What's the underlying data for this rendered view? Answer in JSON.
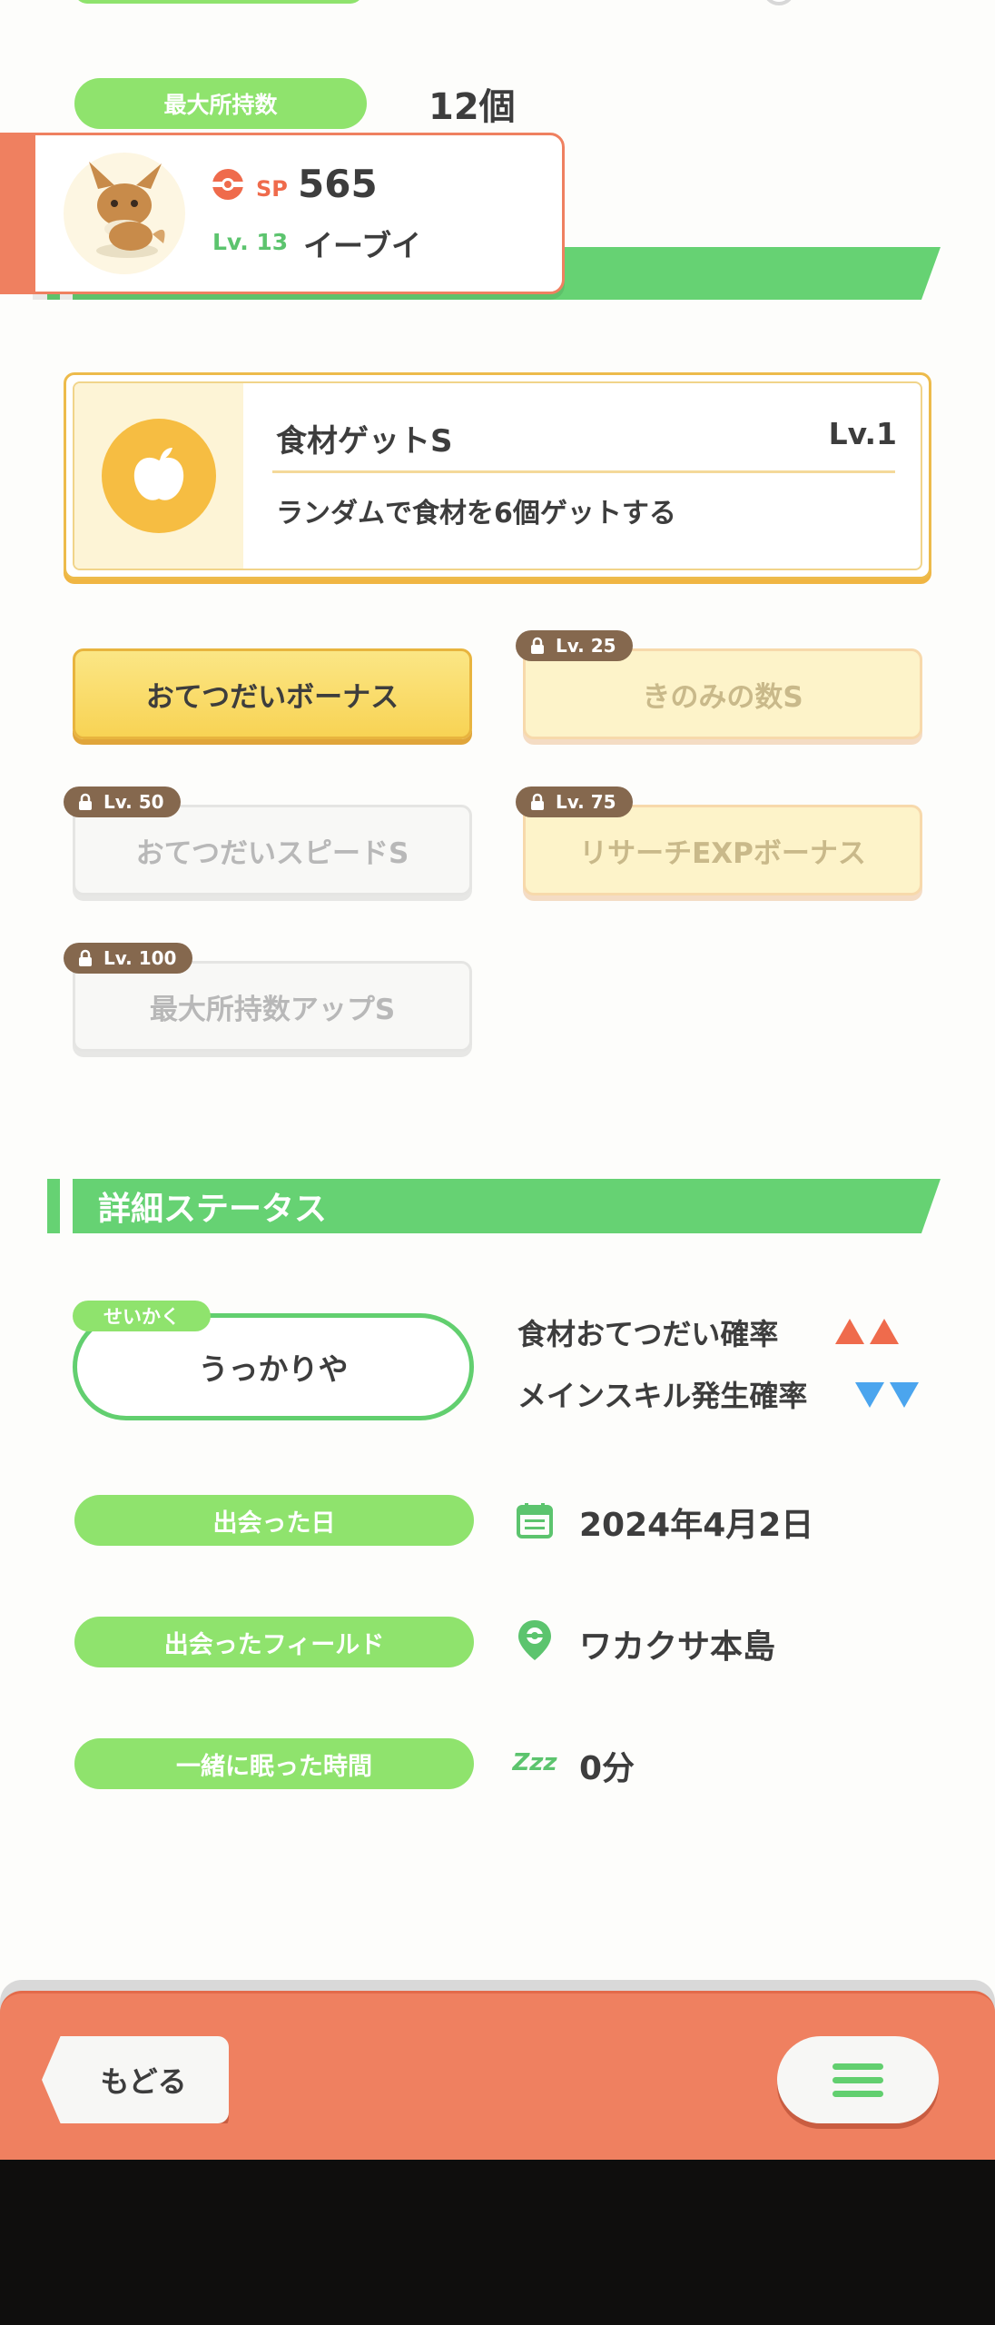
{
  "max_holding": {
    "label": "最大所持数",
    "value": "12個"
  },
  "pokemon": {
    "sp_label": "SP",
    "sp_value": "565",
    "level": "Lv. 13",
    "name": "イーブイ",
    "avatar_icon": "eevee-avatar-icon"
  },
  "main_skill": {
    "name": "食材ゲットS",
    "level": "Lv.1",
    "description": "ランダムで食材を6個ゲットする",
    "icon": "apple-icon"
  },
  "sub_skills": [
    {
      "label": "おてつだいボーナス",
      "lock": "",
      "state": "unlocked"
    },
    {
      "label": "きのみの数S",
      "lock": "Lv. 25",
      "state": "locked"
    },
    {
      "label": "おてつだいスピードS",
      "lock": "Lv. 50",
      "state": "locked"
    },
    {
      "label": "リサーチEXPボーナス",
      "lock": "Lv. 75",
      "state": "locked"
    },
    {
      "label": "最大所持数アップS",
      "lock": "Lv. 100",
      "state": "locked"
    }
  ],
  "details": {
    "header": "詳細ステータス",
    "nature_tag": "せいかく",
    "nature": "うっかりや",
    "trait_up": "食材おてつだい確率",
    "trait_down": "メインスキル発生確率",
    "up_color": "#ef6b4c",
    "down_color": "#4ba5ee",
    "met_date_label": "出会った日",
    "met_date": "2024年4月2日",
    "met_field_label": "出会ったフィールド",
    "met_field": "ワカクサ本島",
    "slept_label": "一緒に眠った時間",
    "slept": "0分",
    "sleep_icon_text": "Zzz"
  },
  "nav": {
    "back": "もどる",
    "menu_icon": "hamburger-menu-icon"
  },
  "colors": {
    "green": "#66d273",
    "light_green": "#8fe36d",
    "coral": "#ef8060",
    "gold": "#f6bd42"
  }
}
